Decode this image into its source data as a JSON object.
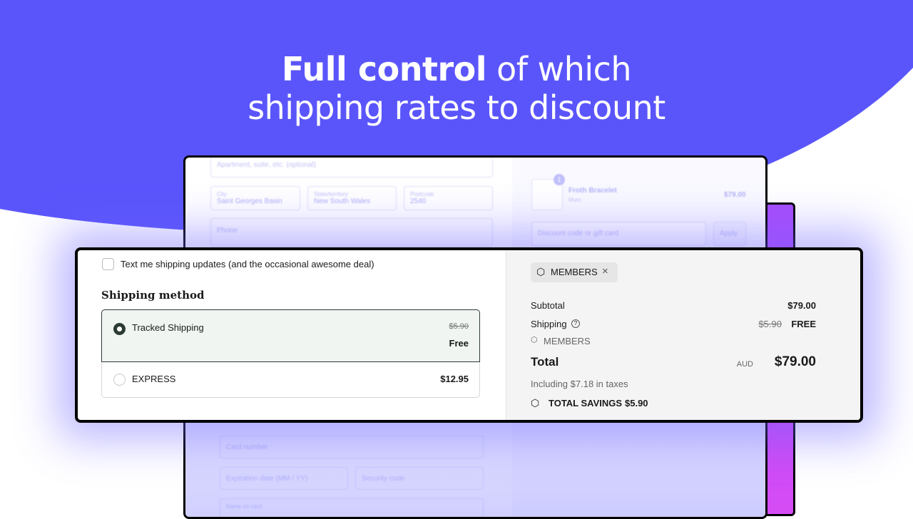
{
  "headline": {
    "bold": "Full control",
    "rest_line1": " of which",
    "line2": "shipping rates to discount"
  },
  "colors": {
    "brand_blue": "#5a55fb",
    "purple": "#c94cf7",
    "selected_bg": "#f0f5f2"
  },
  "background_form": {
    "address2_placeholder": "Apartment, suite, etc. (optional)",
    "city_label": "City",
    "city_value": "Saint Georges Basin",
    "state_label": "State/territory",
    "state_value": "New South Wales",
    "postcode_label": "Postcode",
    "postcode_value": "2540",
    "phone_placeholder": "Phone",
    "card_number_placeholder": "Card number",
    "expiry_placeholder": "Expiration date (MM / YY)",
    "security_placeholder": "Security code",
    "name_on_card_label": "Name on card",
    "product_name": "Froth Bracelet",
    "product_variant": "Mum",
    "product_price": "$79.00",
    "product_qty": "1",
    "discount_placeholder": "Discount code or gift card",
    "apply_label": "Apply"
  },
  "checkout": {
    "sms_optin_label": "Text me shipping updates (and the occasional awesome deal)",
    "shipping_method_title": "Shipping method",
    "options": [
      {
        "name": "Tracked Shipping",
        "original_price": "$5.90",
        "price": "Free",
        "selected": true
      },
      {
        "name": "EXPRESS",
        "price": "$12.95",
        "selected": false
      }
    ]
  },
  "summary": {
    "discount_tag": "MEMBERS",
    "subtotal_label": "Subtotal",
    "subtotal_value": "$79.00",
    "shipping_label": "Shipping",
    "shipping_original": "$5.90",
    "shipping_value": "FREE",
    "shipping_discount_tag": "MEMBERS",
    "total_label": "Total",
    "currency": "AUD",
    "total_value": "$79.00",
    "taxes_note": "Including $7.18 in taxes",
    "savings_label": "TOTAL SAVINGS",
    "savings_value": "$5.90"
  }
}
